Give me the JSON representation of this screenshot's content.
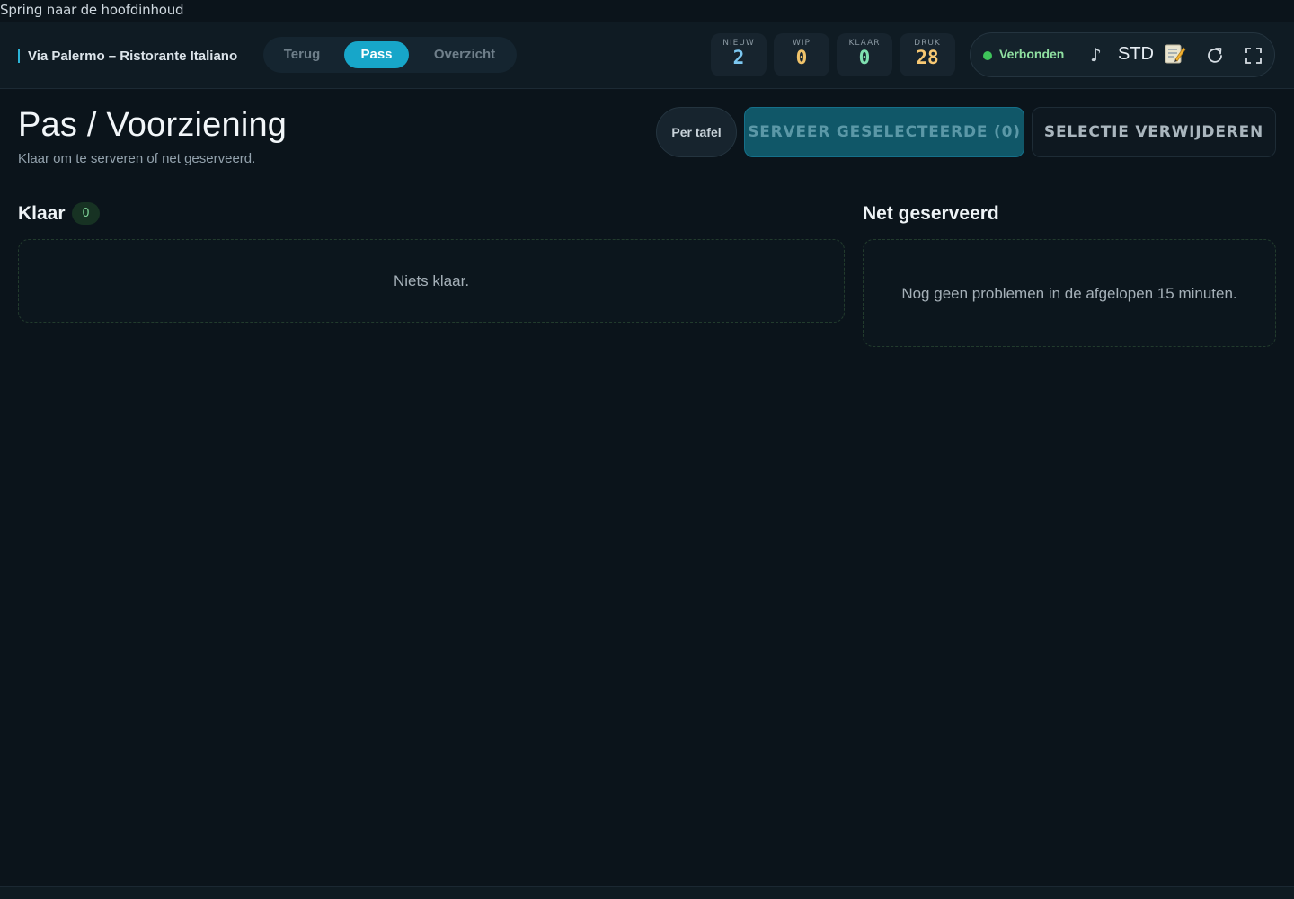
{
  "skip_link": "Spring naar de hoofdinhoud",
  "header": {
    "brand": "Via Palermo – Ristorante Italiano",
    "nav": [
      {
        "label": "Terug",
        "active": false
      },
      {
        "label": "Pass",
        "active": true
      },
      {
        "label": "Overzicht",
        "active": false
      }
    ],
    "counters": [
      {
        "label": "NIEUW",
        "value": "2",
        "color": "#7cc7f0"
      },
      {
        "label": "WIP",
        "value": "0",
        "color": "#f0c36a"
      },
      {
        "label": "KLAAR",
        "value": "0",
        "color": "#7fe0b0"
      },
      {
        "label": "DRUK",
        "value": "28",
        "color": "#f7c873"
      }
    ],
    "status": {
      "connection": "Verbonden",
      "connection_color": "#3ec45a",
      "sound_icon": "music-note-icon",
      "mode": "STD",
      "memo_icon": "memo-icon",
      "refresh_icon": "refresh-icon",
      "fullscreen_icon": "fullscreen-icon"
    }
  },
  "page": {
    "title": "Pas / Voorziening",
    "subtitle": "Klaar om te serveren of net geserveerd.",
    "buttons": {
      "per_table": "Per tafel",
      "serve_selected": "SERVEER GESELECTEERDE (0)",
      "remove_selection": "SELECTIE VERWIJDEREN"
    }
  },
  "sections": {
    "ready": {
      "title": "Klaar",
      "count": "0",
      "empty": "Niets klaar."
    },
    "recently_served": {
      "title": "Net geserveerd",
      "empty": "Nog geen problemen in de afgelopen 15 minuten."
    }
  }
}
